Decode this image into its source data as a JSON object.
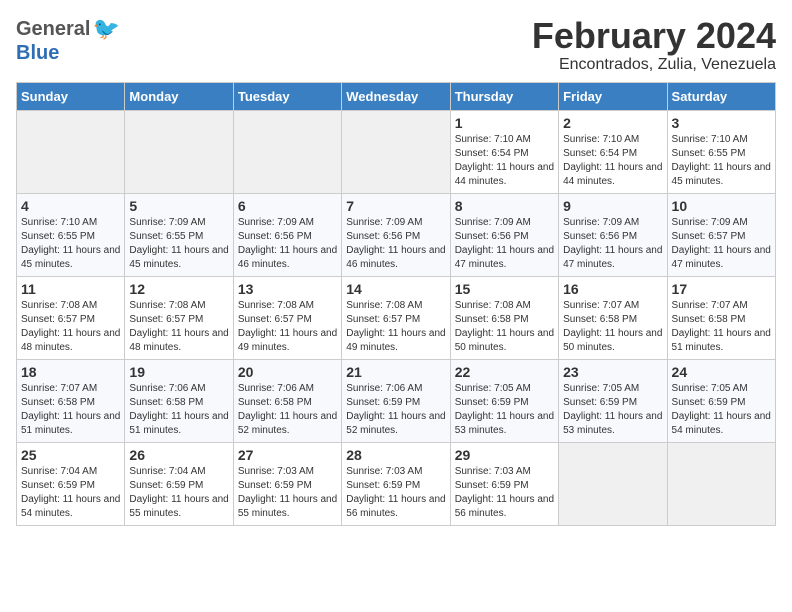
{
  "header": {
    "logo_general": "General",
    "logo_blue": "Blue",
    "title": "February 2024",
    "subtitle": "Encontrados, Zulia, Venezuela"
  },
  "days_of_week": [
    "Sunday",
    "Monday",
    "Tuesday",
    "Wednesday",
    "Thursday",
    "Friday",
    "Saturday"
  ],
  "weeks": [
    [
      {
        "day": "",
        "sunrise": "",
        "sunset": "",
        "daylight": "",
        "empty": true
      },
      {
        "day": "",
        "sunrise": "",
        "sunset": "",
        "daylight": "",
        "empty": true
      },
      {
        "day": "",
        "sunrise": "",
        "sunset": "",
        "daylight": "",
        "empty": true
      },
      {
        "day": "",
        "sunrise": "",
        "sunset": "",
        "daylight": "",
        "empty": true
      },
      {
        "day": "1",
        "sunrise": "Sunrise: 7:10 AM",
        "sunset": "Sunset: 6:54 PM",
        "daylight": "Daylight: 11 hours and 44 minutes.",
        "empty": false
      },
      {
        "day": "2",
        "sunrise": "Sunrise: 7:10 AM",
        "sunset": "Sunset: 6:54 PM",
        "daylight": "Daylight: 11 hours and 44 minutes.",
        "empty": false
      },
      {
        "day": "3",
        "sunrise": "Sunrise: 7:10 AM",
        "sunset": "Sunset: 6:55 PM",
        "daylight": "Daylight: 11 hours and 45 minutes.",
        "empty": false
      }
    ],
    [
      {
        "day": "4",
        "sunrise": "Sunrise: 7:10 AM",
        "sunset": "Sunset: 6:55 PM",
        "daylight": "Daylight: 11 hours and 45 minutes.",
        "empty": false
      },
      {
        "day": "5",
        "sunrise": "Sunrise: 7:09 AM",
        "sunset": "Sunset: 6:55 PM",
        "daylight": "Daylight: 11 hours and 45 minutes.",
        "empty": false
      },
      {
        "day": "6",
        "sunrise": "Sunrise: 7:09 AM",
        "sunset": "Sunset: 6:56 PM",
        "daylight": "Daylight: 11 hours and 46 minutes.",
        "empty": false
      },
      {
        "day": "7",
        "sunrise": "Sunrise: 7:09 AM",
        "sunset": "Sunset: 6:56 PM",
        "daylight": "Daylight: 11 hours and 46 minutes.",
        "empty": false
      },
      {
        "day": "8",
        "sunrise": "Sunrise: 7:09 AM",
        "sunset": "Sunset: 6:56 PM",
        "daylight": "Daylight: 11 hours and 47 minutes.",
        "empty": false
      },
      {
        "day": "9",
        "sunrise": "Sunrise: 7:09 AM",
        "sunset": "Sunset: 6:56 PM",
        "daylight": "Daylight: 11 hours and 47 minutes.",
        "empty": false
      },
      {
        "day": "10",
        "sunrise": "Sunrise: 7:09 AM",
        "sunset": "Sunset: 6:57 PM",
        "daylight": "Daylight: 11 hours and 47 minutes.",
        "empty": false
      }
    ],
    [
      {
        "day": "11",
        "sunrise": "Sunrise: 7:08 AM",
        "sunset": "Sunset: 6:57 PM",
        "daylight": "Daylight: 11 hours and 48 minutes.",
        "empty": false
      },
      {
        "day": "12",
        "sunrise": "Sunrise: 7:08 AM",
        "sunset": "Sunset: 6:57 PM",
        "daylight": "Daylight: 11 hours and 48 minutes.",
        "empty": false
      },
      {
        "day": "13",
        "sunrise": "Sunrise: 7:08 AM",
        "sunset": "Sunset: 6:57 PM",
        "daylight": "Daylight: 11 hours and 49 minutes.",
        "empty": false
      },
      {
        "day": "14",
        "sunrise": "Sunrise: 7:08 AM",
        "sunset": "Sunset: 6:57 PM",
        "daylight": "Daylight: 11 hours and 49 minutes.",
        "empty": false
      },
      {
        "day": "15",
        "sunrise": "Sunrise: 7:08 AM",
        "sunset": "Sunset: 6:58 PM",
        "daylight": "Daylight: 11 hours and 50 minutes.",
        "empty": false
      },
      {
        "day": "16",
        "sunrise": "Sunrise: 7:07 AM",
        "sunset": "Sunset: 6:58 PM",
        "daylight": "Daylight: 11 hours and 50 minutes.",
        "empty": false
      },
      {
        "day": "17",
        "sunrise": "Sunrise: 7:07 AM",
        "sunset": "Sunset: 6:58 PM",
        "daylight": "Daylight: 11 hours and 51 minutes.",
        "empty": false
      }
    ],
    [
      {
        "day": "18",
        "sunrise": "Sunrise: 7:07 AM",
        "sunset": "Sunset: 6:58 PM",
        "daylight": "Daylight: 11 hours and 51 minutes.",
        "empty": false
      },
      {
        "day": "19",
        "sunrise": "Sunrise: 7:06 AM",
        "sunset": "Sunset: 6:58 PM",
        "daylight": "Daylight: 11 hours and 51 minutes.",
        "empty": false
      },
      {
        "day": "20",
        "sunrise": "Sunrise: 7:06 AM",
        "sunset": "Sunset: 6:58 PM",
        "daylight": "Daylight: 11 hours and 52 minutes.",
        "empty": false
      },
      {
        "day": "21",
        "sunrise": "Sunrise: 7:06 AM",
        "sunset": "Sunset: 6:59 PM",
        "daylight": "Daylight: 11 hours and 52 minutes.",
        "empty": false
      },
      {
        "day": "22",
        "sunrise": "Sunrise: 7:05 AM",
        "sunset": "Sunset: 6:59 PM",
        "daylight": "Daylight: 11 hours and 53 minutes.",
        "empty": false
      },
      {
        "day": "23",
        "sunrise": "Sunrise: 7:05 AM",
        "sunset": "Sunset: 6:59 PM",
        "daylight": "Daylight: 11 hours and 53 minutes.",
        "empty": false
      },
      {
        "day": "24",
        "sunrise": "Sunrise: 7:05 AM",
        "sunset": "Sunset: 6:59 PM",
        "daylight": "Daylight: 11 hours and 54 minutes.",
        "empty": false
      }
    ],
    [
      {
        "day": "25",
        "sunrise": "Sunrise: 7:04 AM",
        "sunset": "Sunset: 6:59 PM",
        "daylight": "Daylight: 11 hours and 54 minutes.",
        "empty": false
      },
      {
        "day": "26",
        "sunrise": "Sunrise: 7:04 AM",
        "sunset": "Sunset: 6:59 PM",
        "daylight": "Daylight: 11 hours and 55 minutes.",
        "empty": false
      },
      {
        "day": "27",
        "sunrise": "Sunrise: 7:03 AM",
        "sunset": "Sunset: 6:59 PM",
        "daylight": "Daylight: 11 hours and 55 minutes.",
        "empty": false
      },
      {
        "day": "28",
        "sunrise": "Sunrise: 7:03 AM",
        "sunset": "Sunset: 6:59 PM",
        "daylight": "Daylight: 11 hours and 56 minutes.",
        "empty": false
      },
      {
        "day": "29",
        "sunrise": "Sunrise: 7:03 AM",
        "sunset": "Sunset: 6:59 PM",
        "daylight": "Daylight: 11 hours and 56 minutes.",
        "empty": false
      },
      {
        "day": "",
        "sunrise": "",
        "sunset": "",
        "daylight": "",
        "empty": true
      },
      {
        "day": "",
        "sunrise": "",
        "sunset": "",
        "daylight": "",
        "empty": true
      }
    ]
  ]
}
